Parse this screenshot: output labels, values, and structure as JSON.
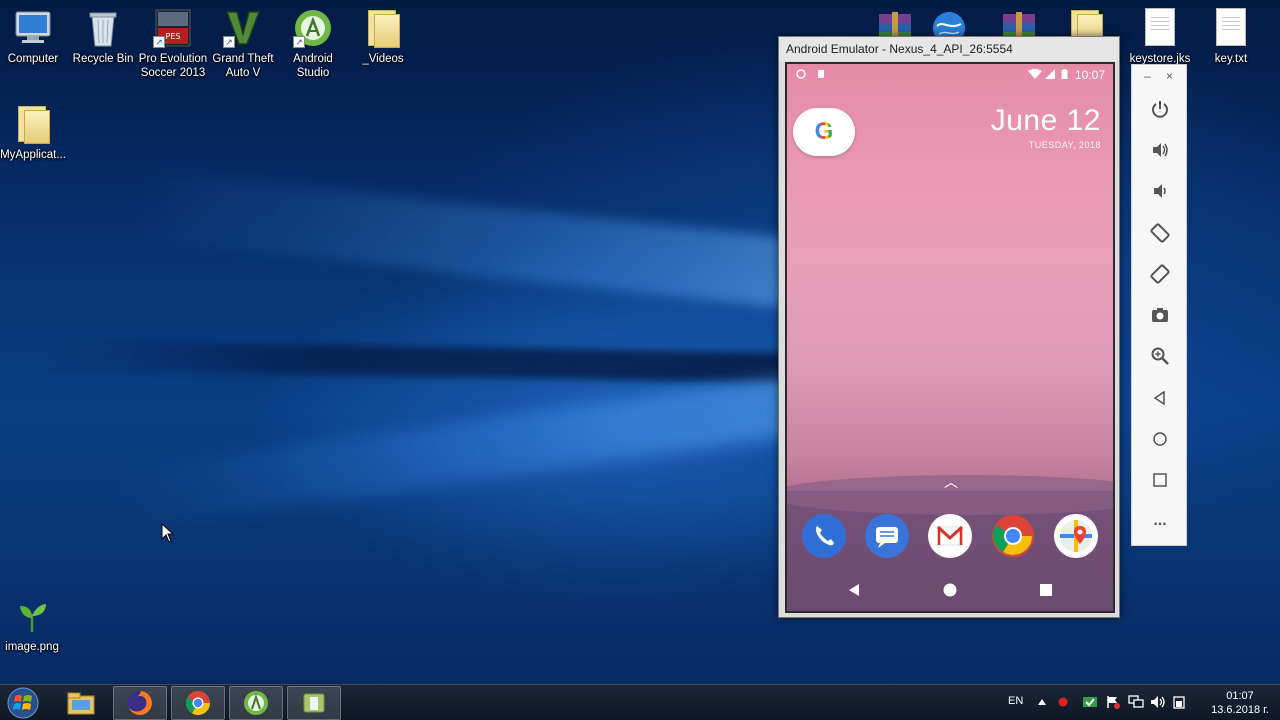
{
  "desktop": {
    "icons": [
      {
        "label": "Computer"
      },
      {
        "label": "Recycle Bin"
      },
      {
        "label": "Pro Evolution Soccer 2013"
      },
      {
        "label": "Grand Theft Auto V"
      },
      {
        "label": "Android Studio"
      },
      {
        "label": "_Videos"
      },
      {
        "label": "MyApplicat..."
      },
      {
        "label": "image.png"
      },
      {
        "label": "keystore.jks"
      },
      {
        "label": "key.txt"
      }
    ]
  },
  "emulator": {
    "title": "Android Emulator - Nexus_4_API_26:5554",
    "status_time": "10:07",
    "date_main": "June 12",
    "date_sub": "TUESDAY, 2018",
    "google_letter": "G",
    "dock_apps": [
      "phone",
      "messages",
      "gmail",
      "chrome",
      "maps"
    ]
  },
  "toolbar": {
    "minimize": "–",
    "close": "×",
    "more": "..."
  },
  "taskbar": {
    "language": "EN",
    "clock_time": "01:07",
    "clock_date": "13.6.2018 г."
  },
  "colors": {
    "accent": "#4285f4"
  }
}
